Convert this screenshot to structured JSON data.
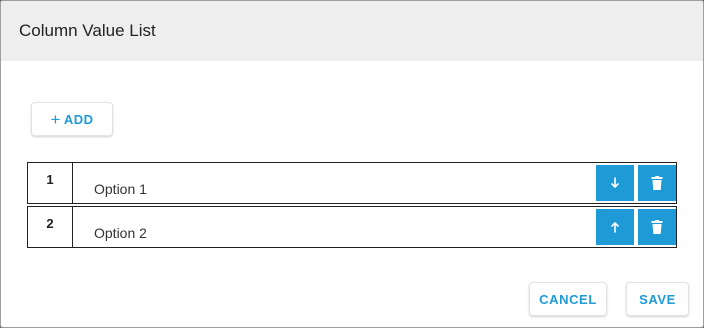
{
  "dialog": {
    "title": "Column Value List",
    "add_label": "ADD",
    "cancel_label": "CANCEL",
    "save_label": "SAVE"
  },
  "rows": [
    {
      "index": "1",
      "value": "Option 1",
      "move_icon": "arrow-down-icon",
      "delete_icon": "trash-icon"
    },
    {
      "index": "2",
      "value": "Option 2",
      "move_icon": "arrow-up-icon",
      "delete_icon": "trash-icon"
    }
  ],
  "colors": {
    "accent": "#1e9bd7",
    "header_bg": "#eeeeee",
    "overlay": "#6b6b6b"
  }
}
